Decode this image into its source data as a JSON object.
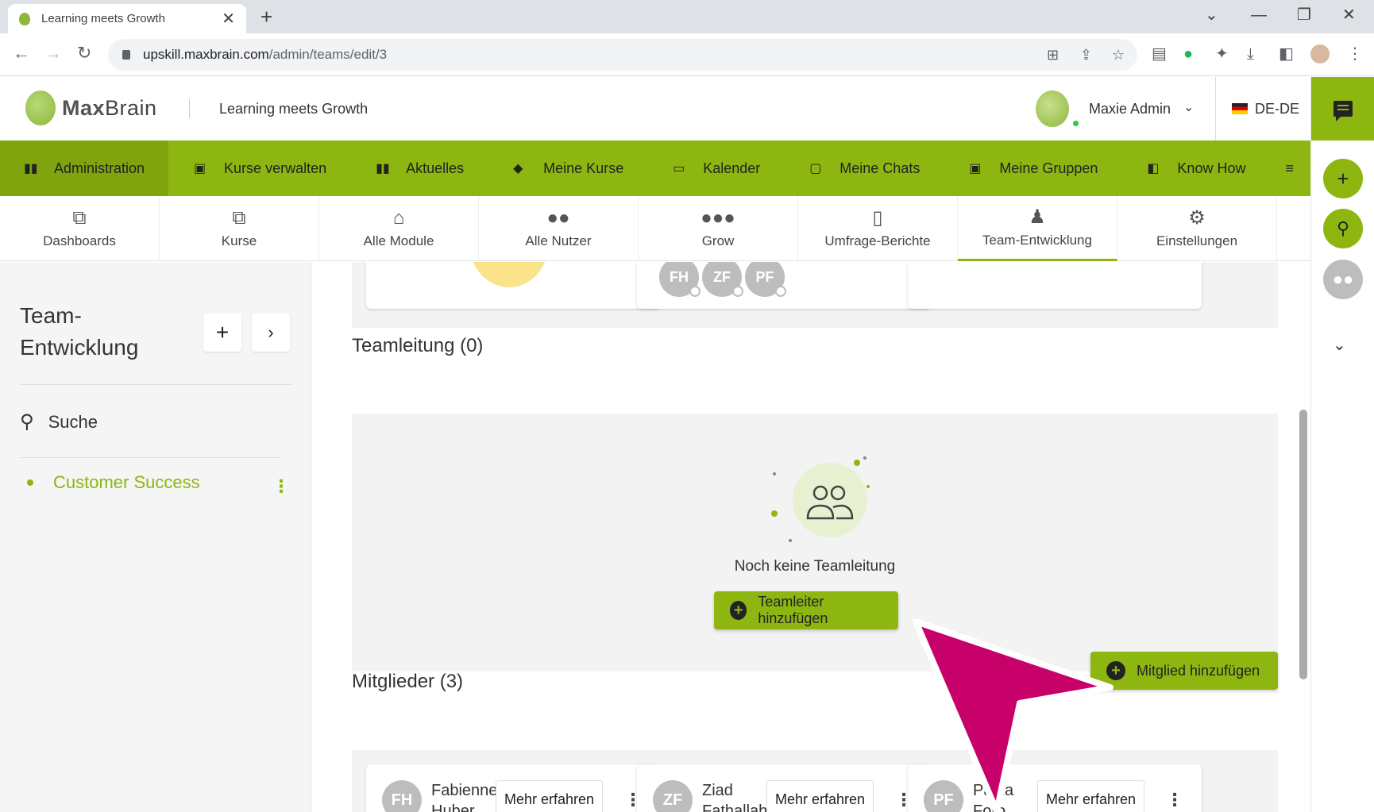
{
  "browser": {
    "tab_title": "Learning meets Growth",
    "url_host": "upskill.maxbrain.com",
    "url_path": "/admin/teams/edit/3"
  },
  "header": {
    "logo_bold": "Max",
    "logo_light": "Brain",
    "subtitle": "Learning meets Growth",
    "user_name": "Maxie Admin",
    "language": "DE-DE"
  },
  "main_nav": [
    {
      "label": "Administration",
      "icon": "dashboard-icon"
    },
    {
      "label": "Kurse verwalten",
      "icon": "course-manage-icon"
    },
    {
      "label": "Aktuelles",
      "icon": "news-icon"
    },
    {
      "label": "Meine Kurse",
      "icon": "graduation-cap-icon"
    },
    {
      "label": "Kalender",
      "icon": "calendar-icon"
    },
    {
      "label": "Meine Chats",
      "icon": "chat-icon"
    },
    {
      "label": "Meine Gruppen",
      "icon": "groups-icon"
    },
    {
      "label": "Know How",
      "icon": "book-icon"
    }
  ],
  "sub_nav": [
    {
      "label": "Dashboards",
      "icon": "book-stack-icon"
    },
    {
      "label": "Kurse",
      "icon": "book-stack-icon"
    },
    {
      "label": "Alle Module",
      "icon": "institution-icon"
    },
    {
      "label": "Alle Nutzer",
      "icon": "users-icon"
    },
    {
      "label": "Grow",
      "icon": "group-icon"
    },
    {
      "label": "Umfrage-Berichte",
      "icon": "report-icon"
    },
    {
      "label": "Team-Entwicklung",
      "icon": "team-icon"
    },
    {
      "label": "Einstellungen",
      "icon": "gears-icon"
    }
  ],
  "sidebar": {
    "title": "Team-\nEntwicklung",
    "search_label": "Suche",
    "team_name": "Customer Success"
  },
  "stats": {
    "avatars": [
      "FH",
      "ZF",
      "PF"
    ]
  },
  "leadership": {
    "title": "Teamleitung (0)",
    "empty_text": "Noch keine Teamleitung",
    "add_button": "Teamleiter hinzufügen"
  },
  "members": {
    "title": "Mitglieder (3)",
    "add_button": "Mitglied hinzufügen",
    "more_label": "Mehr erfahren",
    "items": [
      {
        "initials": "FH",
        "name": "Fabienne Huber"
      },
      {
        "initials": "ZF",
        "name": "Ziad Fathallah"
      },
      {
        "initials": "PF",
        "name": "Paola Foro"
      }
    ]
  },
  "colors": {
    "brand_green": "#8db610",
    "annotation_arrow": "#c8006a"
  }
}
